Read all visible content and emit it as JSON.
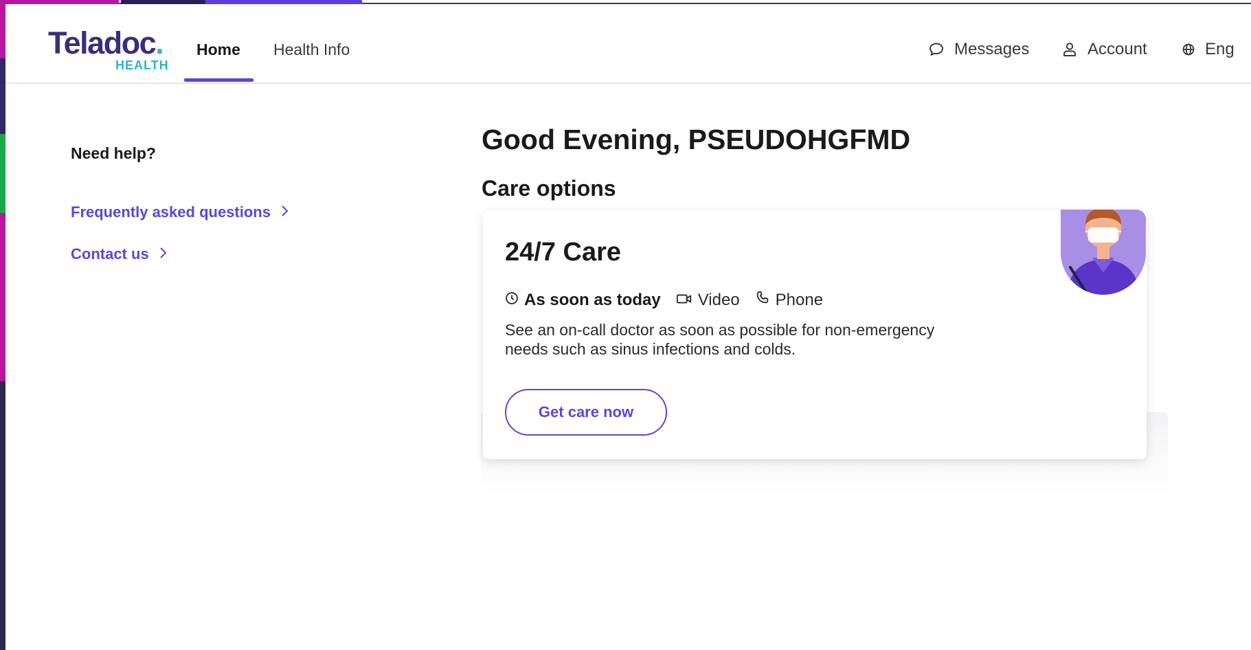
{
  "brand": {
    "logo_text": "Teladoc",
    "logo_dot": ".",
    "logo_sub": "HEALTH",
    "colors": {
      "primary": "#5a48d8",
      "logo_navy": "#3b2d7e",
      "logo_teal": "#2bb7c4"
    }
  },
  "nav": {
    "tabs": [
      {
        "label": "Home",
        "active": true
      },
      {
        "label": "Health Info",
        "active": false
      }
    ],
    "utility": [
      {
        "label": "Messages",
        "icon": "chat-bubble-icon"
      },
      {
        "label": "Account",
        "icon": "user-icon"
      },
      {
        "label": "Eng",
        "icon": "globe-icon"
      }
    ]
  },
  "sidebar": {
    "title": "Need help?",
    "links": [
      {
        "label": "Frequently asked questions",
        "icon": "chevron-right-icon"
      },
      {
        "label": "Contact us",
        "icon": "chevron-right-icon"
      }
    ]
  },
  "main": {
    "greeting": "Good Evening, PSEUDOHGFMD",
    "section_title": "Care options",
    "card": {
      "title": "24/7 Care",
      "availability": "As soon as today",
      "modes": [
        "Video",
        "Phone"
      ],
      "description_line1": "See an on-call doctor as soon as possible for non-emergency",
      "description_line2": "needs such as sinus infections and colds.",
      "cta_label": "Get care now",
      "avatar": "doctor-avatar"
    }
  }
}
